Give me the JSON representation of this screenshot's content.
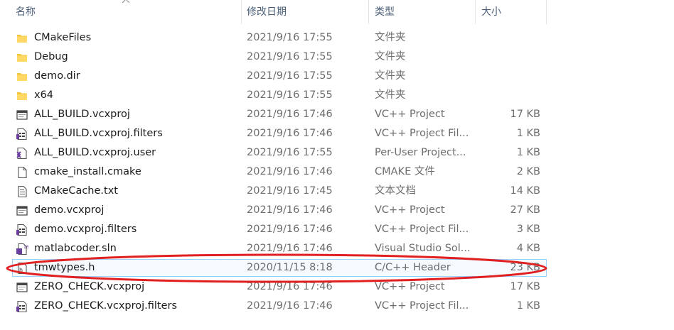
{
  "header": {
    "name": "名称",
    "date": "修改日期",
    "type": "类型",
    "size": "大小"
  },
  "rows": [
    {
      "name": "CMakeFiles",
      "date": "2021/9/16 17:55",
      "type": "文件夹",
      "size": "",
      "icon": "folder-icon"
    },
    {
      "name": "Debug",
      "date": "2021/9/16 17:55",
      "type": "文件夹",
      "size": "",
      "icon": "folder-icon"
    },
    {
      "name": "demo.dir",
      "date": "2021/9/16 17:55",
      "type": "文件夹",
      "size": "",
      "icon": "folder-icon"
    },
    {
      "name": "x64",
      "date": "2021/9/16 17:55",
      "type": "文件夹",
      "size": "",
      "icon": "folder-icon"
    },
    {
      "name": "ALL_BUILD.vcxproj",
      "date": "2021/9/16 17:46",
      "type": "VC++ Project",
      "size": "17 KB",
      "icon": "vcxproj-icon"
    },
    {
      "name": "ALL_BUILD.vcxproj.filters",
      "date": "2021/9/16 17:46",
      "type": "VC++ Project Fil...",
      "size": "1 KB",
      "icon": "filters-icon"
    },
    {
      "name": "ALL_BUILD.vcxproj.user",
      "date": "2021/9/16 17:55",
      "type": "Per-User Project...",
      "size": "1 KB",
      "icon": "user-project-icon"
    },
    {
      "name": "cmake_install.cmake",
      "date": "2021/9/16 17:46",
      "type": "CMAKE 文件",
      "size": "2 KB",
      "icon": "blank-file-icon"
    },
    {
      "name": "CMakeCache.txt",
      "date": "2021/9/16 17:45",
      "type": "文本文档",
      "size": "14 KB",
      "icon": "text-file-icon"
    },
    {
      "name": "demo.vcxproj",
      "date": "2021/9/16 17:46",
      "type": "VC++ Project",
      "size": "27 KB",
      "icon": "vcxproj-icon"
    },
    {
      "name": "demo.vcxproj.filters",
      "date": "2021/9/16 17:46",
      "type": "VC++ Project Fil...",
      "size": "3 KB",
      "icon": "filters-icon"
    },
    {
      "name": "matlabcoder.sln",
      "date": "2021/9/16 17:46",
      "type": "Visual Studio Sol...",
      "size": "4 KB",
      "icon": "solution-icon"
    },
    {
      "name": "tmwtypes.h",
      "date": "2020/11/15 8:18",
      "type": "C/C++ Header",
      "size": "23 KB",
      "icon": "header-file-icon",
      "selected": true
    },
    {
      "name": "ZERO_CHECK.vcxproj",
      "date": "2021/9/16 17:46",
      "type": "VC++ Project",
      "size": "17 KB",
      "icon": "vcxproj-icon"
    },
    {
      "name": "ZERO_CHECK.vcxproj.filters",
      "date": "2021/9/16 17:46",
      "type": "VC++ Project Fil...",
      "size": "1 KB",
      "icon": "filters-icon"
    }
  ],
  "colors": {
    "annotation": "#e02020",
    "selection_border": "#99d1ff",
    "folder": "#f5c642"
  }
}
